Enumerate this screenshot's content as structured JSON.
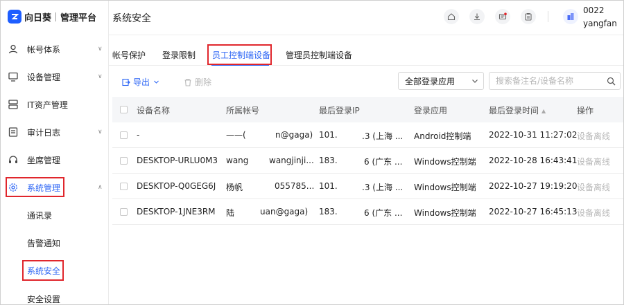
{
  "app": {
    "logo_text": "向日葵",
    "subtitle": "管理平台"
  },
  "sidebar": {
    "items": [
      {
        "label": "帐号体系",
        "icon": "user-icon",
        "chevron": "∨"
      },
      {
        "label": "设备管理",
        "icon": "monitor-icon",
        "chevron": "∨"
      },
      {
        "label": "IT资产管理",
        "icon": "server-icon"
      },
      {
        "label": "审计日志",
        "icon": "log-icon",
        "chevron": "∨"
      },
      {
        "label": "坐席管理",
        "icon": "headset-icon"
      },
      {
        "label": "系统管理",
        "icon": "gear-icon",
        "chevron": "∧",
        "active": true
      }
    ],
    "subitems": [
      "通讯录",
      "告警通知",
      "系统安全",
      "安全设置"
    ],
    "accent_color": "#2d66f5",
    "highlight_color": "#e0262c"
  },
  "header": {
    "title": "系统安全",
    "icons": [
      "home-icon",
      "download-icon",
      "message-icon",
      "clipboard-icon"
    ],
    "user_id": "0022",
    "user_name": "yangfan"
  },
  "tabs": [
    "帐号保护",
    "登录限制",
    "员工控制端设备",
    "管理员控制端设备"
  ],
  "toolbar": {
    "export_label": "导出",
    "delete_label": "删除",
    "app_select": "全部登录应用",
    "search_placeholder": "搜索备注名/设备名称"
  },
  "table": {
    "columns": [
      "设备名称",
      "所属帐号",
      "最后登录IP",
      "登录应用",
      "最后登录时间",
      "操作"
    ],
    "rows": [
      {
        "device": "-",
        "account_a": "——(",
        "account_b": "n@gaga)",
        "ip_a": "101.",
        "ip_b": ".3 (上海 ...",
        "app": "Android控制端",
        "time": "2022-10-31 11:27:02",
        "action": "设备离线"
      },
      {
        "device": "DESKTOP-URLU0M3",
        "account_a": "wang",
        "account_b": "wangjinji...",
        "ip_a": "183.",
        "ip_b": "6 (广东 ...",
        "app": "Windows控制端",
        "time": "2022-10-28 16:43:41",
        "action": "设备离线"
      },
      {
        "device": "DESKTOP-Q0GEG6J",
        "account_a": "杨帆",
        "account_b": "055785...",
        "ip_a": "101.",
        "ip_b": ".3 (上海 ...",
        "app": "Windows控制端",
        "time": "2022-10-27 19:19:20",
        "action": "设备离线"
      },
      {
        "device": "DESKTOP-1JNE3RM",
        "account_a": "陆",
        "account_b": "uan@gaga)",
        "ip_a": "183.",
        "ip_b": "6 (广东 ...",
        "app": "Windows控制端",
        "time": "2022-10-27 16:45:13",
        "action": "设备离线"
      }
    ]
  }
}
